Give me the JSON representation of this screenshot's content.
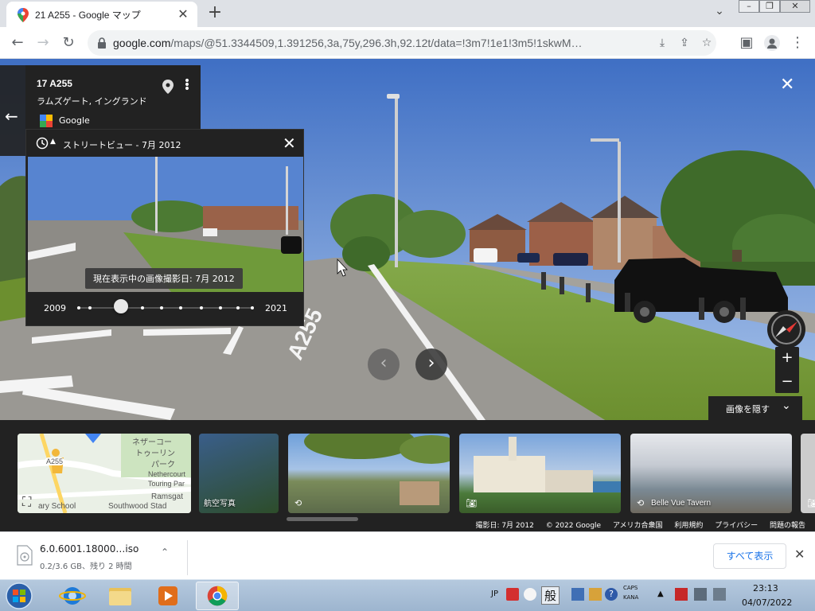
{
  "browser": {
    "tab_title": "21 A255 - Google マップ",
    "url_host": "google.com",
    "url_path": "/maps/@51.3344509,1.391256,3a,75y,296.3h,92.12t/data=!3m7!1e1!3m5!1skwM…"
  },
  "place_card": {
    "title": "17 A255",
    "subtitle": "ラムズゲート, イングランド",
    "provider": "Google"
  },
  "time_machine": {
    "label": "ストリートビュー - 7月 2012",
    "tooltip": "現在表示中の画像撮影日: 7月 2012",
    "year_start": "2009",
    "year_end": "2021",
    "dot_count": 10,
    "selected_index": 2,
    "selected_fraction": 0.25
  },
  "viewer": {
    "hide_images_label": "画像を隠す",
    "road_marking": "A255"
  },
  "filmstrip": {
    "map_labels": [
      "ネザーコー",
      "トゥーリン",
      "パーク",
      "Nethercourt",
      "Touring Par",
      "Ramsgat",
      "Southwood Stad",
      "ary School",
      "A255"
    ],
    "cards": [
      {
        "label": "航空写真"
      },
      {
        "label": ""
      },
      {
        "label": ""
      },
      {
        "label": "Belle Vue Tavern"
      }
    ],
    "attribution": [
      "撮影日: 7月 2012",
      "© 2022 Google",
      "アメリカ合衆国",
      "利用規約",
      "プライバシー",
      "問題の報告"
    ]
  },
  "downloads": {
    "file_name": "6.0.6001.18000…iso",
    "status": "0.2/3.6 GB、残り 2 時間",
    "show_all_label": "すべて表示"
  },
  "taskbar": {
    "ime_label": "JP",
    "ime_mode": "般",
    "caps": "CAPS",
    "kana": "KANA",
    "time": "23:13",
    "date": "04/07/2022"
  },
  "colors": {
    "accent_blue": "#1a73e8",
    "panel_dark": "#222222",
    "sky": "#5f8fd6",
    "grass": "#6f9a3a"
  }
}
